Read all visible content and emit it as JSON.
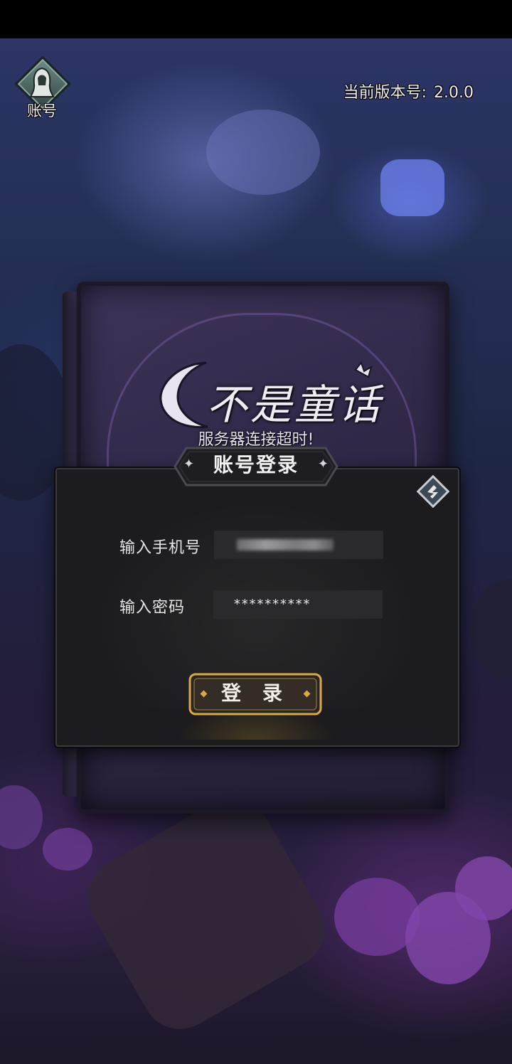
{
  "header": {
    "account_label": "账号",
    "version_label": "当前版本号:",
    "version_value": "2.0.0"
  },
  "game": {
    "logo_text": "不是童话",
    "server_message": "服务器连接超时!"
  },
  "login_dialog": {
    "title": "账号登录",
    "phone_label": "输入手机号",
    "password_label": "输入密码",
    "password_value": "**********",
    "login_button": "登 录",
    "switch_icon": "switch-account-icon"
  },
  "colors": {
    "dialog_bg": "#1c1c1e",
    "button_border": "#d8a94a",
    "field_bg": "#2a2a2d"
  }
}
